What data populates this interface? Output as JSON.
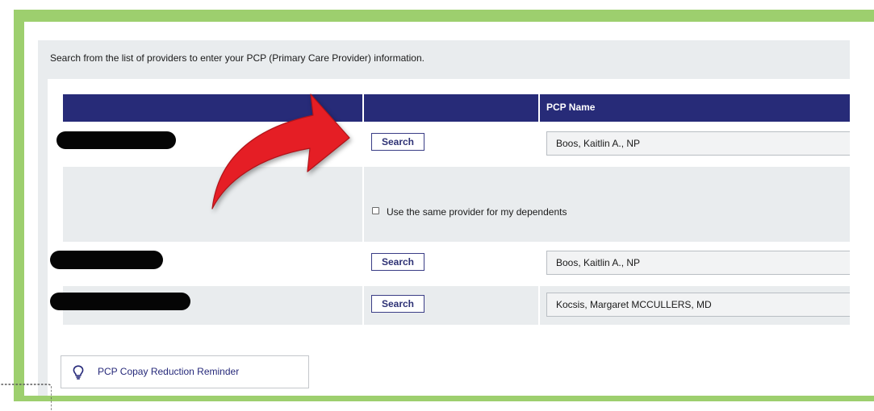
{
  "intro": {
    "text": "Search from the list of providers to enter your PCP (Primary Care Provider) information."
  },
  "table": {
    "column_headers": [
      "",
      "",
      "PCP Name"
    ],
    "rows": [
      {
        "search_label": "Search",
        "pcp_name": "Boos, Kaitlin A., NP"
      },
      {
        "search_label": "Search",
        "pcp_name": "Boos, Kaitlin A., NP"
      },
      {
        "search_label": "Search",
        "pcp_name": "Kocsis, Margaret MCCULLERS, MD"
      }
    ],
    "dependents_checkbox": {
      "label": "Use the same provider for my dependents",
      "checked": false
    }
  },
  "reminder": {
    "label": "PCP Copay Reduction Reminder",
    "icon": "lightbulb-icon"
  },
  "colors": {
    "frame_green": "#9dcf6e",
    "header_navy": "#272b78",
    "row_gray": "#e9ecee",
    "annotation_arrow": "#e51e25"
  }
}
